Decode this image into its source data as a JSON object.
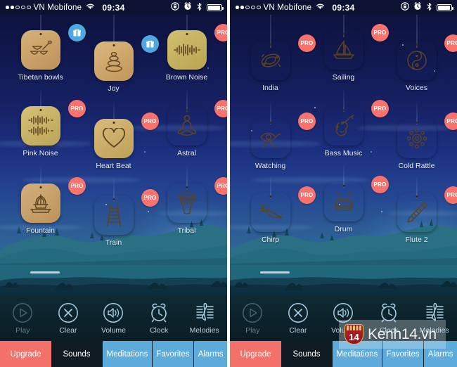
{
  "status_bar": {
    "signal_dots_filled": 2,
    "signal_dots_total": 5,
    "carrier": "VN Mobifone",
    "wifi_icon": "wifi-icon",
    "time": "09:34",
    "icons": [
      "rotation-lock-icon",
      "alarm-icon",
      "bluetooth-icon",
      "battery-icon"
    ]
  },
  "screens": [
    {
      "name": "left-screen",
      "sounds": [
        {
          "name": "Tibetan bowls",
          "badge": "GIFT",
          "icon": "tibetan-bowls-icon",
          "tile_color": "#c8a06a"
        },
        {
          "name": "Joy",
          "badge": "GIFT",
          "icon": "stacked-stones-icon",
          "tile_color": "#cfa96d"
        },
        {
          "name": "Brown Noise",
          "badge": "PRO",
          "icon": "waveform-icon",
          "tile_color": "#c4b15e"
        },
        {
          "name": "Pink Noise",
          "badge": "PRO",
          "icon": "double-waveform-icon",
          "tile_color": "#c8b265"
        },
        {
          "name": "Heart Beat",
          "badge": "PRO",
          "icon": "heart-icon",
          "tile_color": "#c8ab64"
        },
        {
          "name": "Astral",
          "badge": "PRO",
          "icon": "meditation-icon",
          "tile_color": "#c9a271"
        },
        {
          "name": "Fountain",
          "badge": "PRO",
          "icon": "fountain-icon",
          "tile_color": "#c6a06d"
        },
        {
          "name": "Train",
          "badge": "PRO",
          "icon": "railway-icon",
          "tile_color": "#c9a86a"
        },
        {
          "name": "Tribal",
          "badge": "PRO",
          "icon": "djembe-drum-icon",
          "tile_color": "#c6a273"
        }
      ],
      "watermark": null
    },
    {
      "name": "right-screen",
      "sounds": [
        {
          "name": "India",
          "badge": "PRO",
          "icon": "tambourine-icon",
          "tile_color": "#c6a174"
        },
        {
          "name": "Sailing",
          "badge": "PRO",
          "icon": "sailboat-icon",
          "tile_color": "#c8b061"
        },
        {
          "name": "Voices",
          "badge": "PRO",
          "icon": "yin-yang-icon",
          "tile_color": "#c5a276"
        },
        {
          "name": "Watching",
          "badge": "PRO",
          "icon": "eye-of-horus-icon",
          "tile_color": "#c6a474"
        },
        {
          "name": "Bass Music",
          "badge": "PRO",
          "icon": "violin-icon",
          "tile_color": "#c7a66f"
        },
        {
          "name": "Cold Rattle",
          "badge": "PRO",
          "icon": "rattle-icon",
          "tile_color": "#c6b062"
        },
        {
          "name": "Chirp",
          "badge": "PRO",
          "icon": "bird-icon",
          "tile_color": "#c8af62"
        },
        {
          "name": "Drum",
          "badge": "PRO",
          "icon": "snare-drum-icon",
          "tile_color": "#c6a273"
        },
        {
          "name": "Flute 2",
          "badge": "PRO",
          "icon": "flute-icon",
          "tile_color": "#c6a070"
        }
      ],
      "watermark": {
        "number": "14",
        "text": "Kenh14.vn"
      }
    }
  ],
  "toolbar": [
    {
      "label": "Play",
      "icon": "play-circle-icon",
      "disabled": true
    },
    {
      "label": "Clear",
      "icon": "close-circle-icon",
      "disabled": false
    },
    {
      "label": "Volume",
      "icon": "speaker-icon",
      "disabled": false
    },
    {
      "label": "Clock",
      "icon": "alarm-clock-icon",
      "disabled": false
    },
    {
      "label": "Melodies",
      "icon": "treble-clef-icon",
      "disabled": false
    }
  ],
  "tabs": [
    {
      "label": "Upgrade",
      "style": "upgrade"
    },
    {
      "label": "Sounds",
      "style": "active"
    },
    {
      "label": "Meditations",
      "style": "normal"
    },
    {
      "label": "Favorites",
      "style": "normal"
    },
    {
      "label": "Alarms",
      "style": "normal"
    }
  ],
  "colors": {
    "upgrade_tab": "#f4716b",
    "active_tab": "#0f1a22",
    "normal_tab": "#5cabda",
    "pro_badge": "#f9726d",
    "gift_badge": "#4fa8e0",
    "toolbar_text": "#b9d3e4"
  }
}
